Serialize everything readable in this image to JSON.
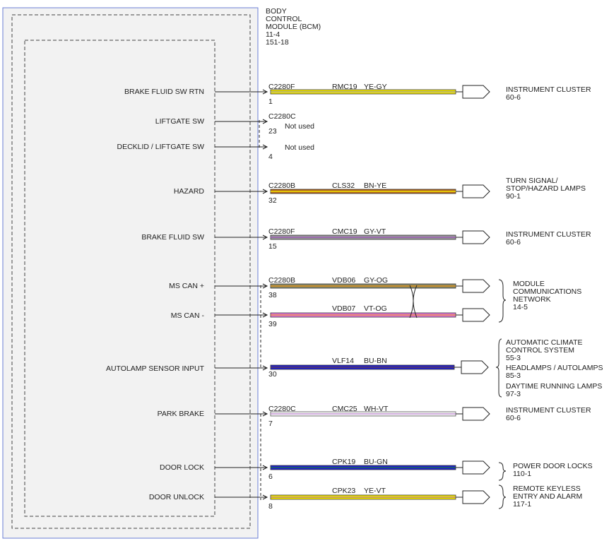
{
  "module": {
    "title_lines": [
      "BODY",
      "CONTROL",
      "MODULE (BCM)",
      "11-4",
      "151-18"
    ]
  },
  "circuits": [
    {
      "id": "brake-fluid-sw-rtn",
      "label": "BRAKE FLUID SW RTN",
      "connector": "C2280F",
      "pin": "1",
      "circuit": "RMC19",
      "color_code": "YE-GY",
      "colors": [
        "#f2e600",
        "#9a9a9a"
      ],
      "dest": [
        "INSTRUMENT CLUSTER",
        "60-6"
      ],
      "note": ""
    },
    {
      "id": "liftgate-sw",
      "label": "LIFTGATE SW",
      "connector": "C2280C",
      "pin": "23",
      "circuit": "",
      "color_code": "",
      "colors": [],
      "dest": [],
      "note": "Not used"
    },
    {
      "id": "decklid-liftgate-sw",
      "label": "DECKLID / LIFTGATE SW",
      "connector": "",
      "pin": "4",
      "circuit": "",
      "color_code": "",
      "colors": [],
      "dest": [],
      "note": "Not used"
    },
    {
      "id": "hazard",
      "label": "HAZARD",
      "connector": "C2280B",
      "pin": "32",
      "circuit": "CLS32",
      "color_code": "BN-YE",
      "colors": [
        "#b5651d",
        "#f2e600"
      ],
      "dest": [
        "TURN SIGNAL/",
        "STOP/HAZARD LAMPS",
        "90-1"
      ],
      "note": ""
    },
    {
      "id": "brake-fluid-sw",
      "label": "BRAKE FLUID SW",
      "connector": "C2280F",
      "pin": "15",
      "circuit": "CMC19",
      "color_code": "GY-VT",
      "colors": [
        "#9a9a9a",
        "#9b59b6"
      ],
      "dest": [
        "INSTRUMENT CLUSTER",
        "60-6"
      ],
      "note": ""
    },
    {
      "id": "ms-can-plus",
      "label": "MS CAN +",
      "connector": "C2280B",
      "pin": "38",
      "circuit": "VDB06",
      "color_code": "GY-OG",
      "colors": [
        "#9a9a9a",
        "#e68a00"
      ],
      "dest": [],
      "note": ""
    },
    {
      "id": "ms-can-minus",
      "label": "MS CAN -",
      "connector": "",
      "pin": "39",
      "circuit": "VDB07",
      "color_code": "VT-OG",
      "colors": [
        "#e07ad8",
        "#e68a00"
      ],
      "dest": [],
      "note": ""
    },
    {
      "id": "autolamp-sensor-input",
      "label": "AUTOLAMP SENSOR INPUT",
      "connector": "",
      "pin": "30",
      "circuit": "VLF14",
      "color_code": "BU-BN",
      "colors": [
        "#1f1fd0",
        "#7a4a1a"
      ],
      "dest": [],
      "note": ""
    },
    {
      "id": "park-brake",
      "label": "PARK BRAKE",
      "connector": "C2280C",
      "pin": "7",
      "circuit": "CMC25",
      "color_code": "WH-VT",
      "colors": [
        "#f4f4f4",
        "#b06ac8"
      ],
      "dest": [
        "INSTRUMENT CLUSTER",
        "60-6"
      ],
      "note": ""
    },
    {
      "id": "door-lock",
      "label": "DOOR LOCK",
      "connector": "",
      "pin": "6",
      "circuit": "CPK19",
      "color_code": "BU-GN",
      "colors": [
        "#1f1fd0",
        "#1a8a1a"
      ],
      "dest": [],
      "note": ""
    },
    {
      "id": "door-unlock",
      "label": "DOOR UNLOCK",
      "connector": "",
      "pin": "8",
      "circuit": "CPK23",
      "color_code": "YE-VT",
      "colors": [
        "#f2e600",
        "#9b59b6"
      ],
      "dest": [],
      "note": ""
    }
  ],
  "groups": [
    {
      "id": "ms-can",
      "lines": [
        "MODULE",
        "COMMUNICATIONS",
        "NETWORK",
        "14-5"
      ]
    },
    {
      "id": "autolamp",
      "sections": [
        [
          "AUTOMATIC CLIMATE",
          "CONTROL SYSTEM",
          "55-3"
        ],
        [
          "HEADLAMPS / AUTOLAMPS",
          "85-3"
        ],
        [
          "DAYTIME RUNNING LAMPS",
          "97-3"
        ]
      ]
    },
    {
      "id": "door-lock",
      "lines": [
        "POWER DOOR LOCKS",
        "110-1"
      ]
    },
    {
      "id": "door-unlock",
      "lines": [
        "REMOTE KEYLESS",
        "ENTRY AND ALARM",
        "117-1"
      ]
    }
  ],
  "colors": {
    "module_border": "#6b7fd6",
    "module_fill": "#f2f2f2",
    "wire_outline": "#333333"
  }
}
